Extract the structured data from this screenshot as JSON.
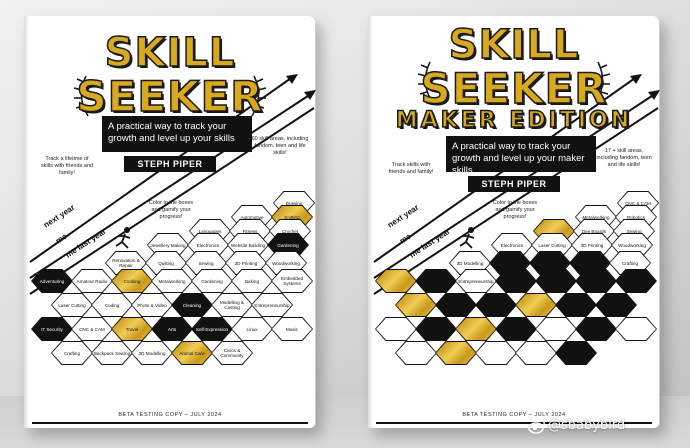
{
  "watermark": "@sbabybird",
  "books": [
    {
      "id": "left",
      "title_line1": "SKILL",
      "title_line2": "SEEKER",
      "tagline": "A practical way to track your growth and level up your skills",
      "author": "STEPH PIPER",
      "note_left": "Track a lifetime of skills with friends and family!",
      "note_right": "60 skill areas, including fandom, teen and life skills!",
      "note_color": "Color in the boxes and gamify your progress!",
      "arrow_labels": [
        "next year",
        "me",
        "me last year"
      ],
      "footer": "BETA TESTING COPY – JULY 2024",
      "hexes": [
        {
          "label": "Drawing",
          "fill": "w"
        },
        {
          "label": "Automotive",
          "fill": "w"
        },
        {
          "label": "Knitting",
          "fill": "g"
        },
        {
          "label": "Languages",
          "fill": "w"
        },
        {
          "label": "Fitness",
          "fill": "w"
        },
        {
          "label": "Crochet",
          "fill": "w"
        },
        {
          "label": "Jewellery Making",
          "fill": "w"
        },
        {
          "label": "Electronics",
          "fill": "w"
        },
        {
          "label": "Website Building",
          "fill": "w"
        },
        {
          "label": "Gardening",
          "fill": "b"
        },
        {
          "label": "Renovation & Repair",
          "fill": "w"
        },
        {
          "label": "Quilting",
          "fill": "w"
        },
        {
          "label": "Sewing",
          "fill": "w"
        },
        {
          "label": "3D Printing",
          "fill": "w"
        },
        {
          "label": "Woodworking",
          "fill": "w"
        },
        {
          "label": "Adventuring",
          "fill": "b"
        },
        {
          "label": "Amateur Radio",
          "fill": "w"
        },
        {
          "label": "Cooking",
          "fill": "g"
        },
        {
          "label": "Metalworking",
          "fill": "w"
        },
        {
          "label": "Gardening",
          "fill": "w"
        },
        {
          "label": "Baking",
          "fill": "w"
        },
        {
          "label": "Embedded Systems",
          "fill": "w"
        },
        {
          "label": "Laser Cutting",
          "fill": "w"
        },
        {
          "label": "Coding",
          "fill": "w"
        },
        {
          "label": "Photo & Video",
          "fill": "w"
        },
        {
          "label": "Cleaning",
          "fill": "b"
        },
        {
          "label": "Modelling & Casting",
          "fill": "w"
        },
        {
          "label": "Entrepreneurship",
          "fill": "w"
        },
        {
          "label": "IT Security",
          "fill": "b"
        },
        {
          "label": "CNC & CAM",
          "fill": "w"
        },
        {
          "label": "Travel",
          "fill": "g"
        },
        {
          "label": "Arts",
          "fill": "b"
        },
        {
          "label": "Self-Expression",
          "fill": "b"
        },
        {
          "label": "Linux",
          "fill": "w"
        },
        {
          "label": "Music",
          "fill": "w"
        },
        {
          "label": "Crafting",
          "fill": "w"
        },
        {
          "label": "Backpack Sewing",
          "fill": "w"
        },
        {
          "label": "3D Modelling",
          "fill": "w"
        },
        {
          "label": "Animal Care",
          "fill": "g"
        },
        {
          "label": "Civics & Community",
          "fill": "w"
        }
      ]
    },
    {
      "id": "right",
      "title_line1": "SKILL",
      "title_line2": "SEEKER",
      "title_line3": "MAKER EDITION",
      "tagline": "A practical way to track your growth and level up your maker skills",
      "author": "STEPH PIPER",
      "note_left": "Track skills with friends and family!",
      "note_right": "17 + skill areas, including fandom, teen and life skills!",
      "note_color": "Color in the boxes and gamify your progress!",
      "arrow_labels": [
        "next year",
        "me",
        "me last year"
      ],
      "footer": "BETA TESTING COPY – JULY 2024",
      "hexes": [
        {
          "label": "CNC & CAM",
          "fill": "w"
        },
        {
          "label": "Metalworking",
          "fill": "w"
        },
        {
          "label": "Robotics",
          "fill": "w"
        },
        {
          "label": "",
          "fill": "g"
        },
        {
          "label": "Dev Boards",
          "fill": "w"
        },
        {
          "label": "Sewing",
          "fill": "w"
        },
        {
          "label": "Electronics",
          "fill": "w"
        },
        {
          "label": "Laser Cutting",
          "fill": "w"
        },
        {
          "label": "3D Printing",
          "fill": "w"
        },
        {
          "label": "Woodworking",
          "fill": "w"
        },
        {
          "label": "3D Modelling",
          "fill": "w"
        },
        {
          "label": "",
          "fill": "b"
        },
        {
          "label": "",
          "fill": "b"
        },
        {
          "label": "",
          "fill": "b"
        },
        {
          "label": "Crafting",
          "fill": "w"
        },
        {
          "label": "",
          "fill": "g"
        },
        {
          "label": "",
          "fill": "b"
        },
        {
          "label": "Entrepreneurship",
          "fill": "w"
        },
        {
          "label": "",
          "fill": "b"
        },
        {
          "label": "",
          "fill": "b"
        },
        {
          "label": "",
          "fill": "b"
        },
        {
          "label": "",
          "fill": "b"
        },
        {
          "label": "",
          "fill": "g"
        },
        {
          "label": "",
          "fill": "b"
        },
        {
          "label": "",
          "fill": "b"
        },
        {
          "label": "",
          "fill": "g"
        },
        {
          "label": "",
          "fill": "b"
        },
        {
          "label": "",
          "fill": "b"
        },
        {
          "label": "",
          "fill": "w"
        },
        {
          "label": "",
          "fill": "b"
        },
        {
          "label": "",
          "fill": "g"
        },
        {
          "label": "",
          "fill": "b"
        },
        {
          "label": "",
          "fill": "w"
        },
        {
          "label": "",
          "fill": "b"
        },
        {
          "label": "",
          "fill": "w"
        },
        {
          "label": "",
          "fill": "w"
        },
        {
          "label": "",
          "fill": "g"
        },
        {
          "label": "",
          "fill": "w"
        },
        {
          "label": "",
          "fill": "w"
        },
        {
          "label": "",
          "fill": "b"
        }
      ]
    }
  ]
}
